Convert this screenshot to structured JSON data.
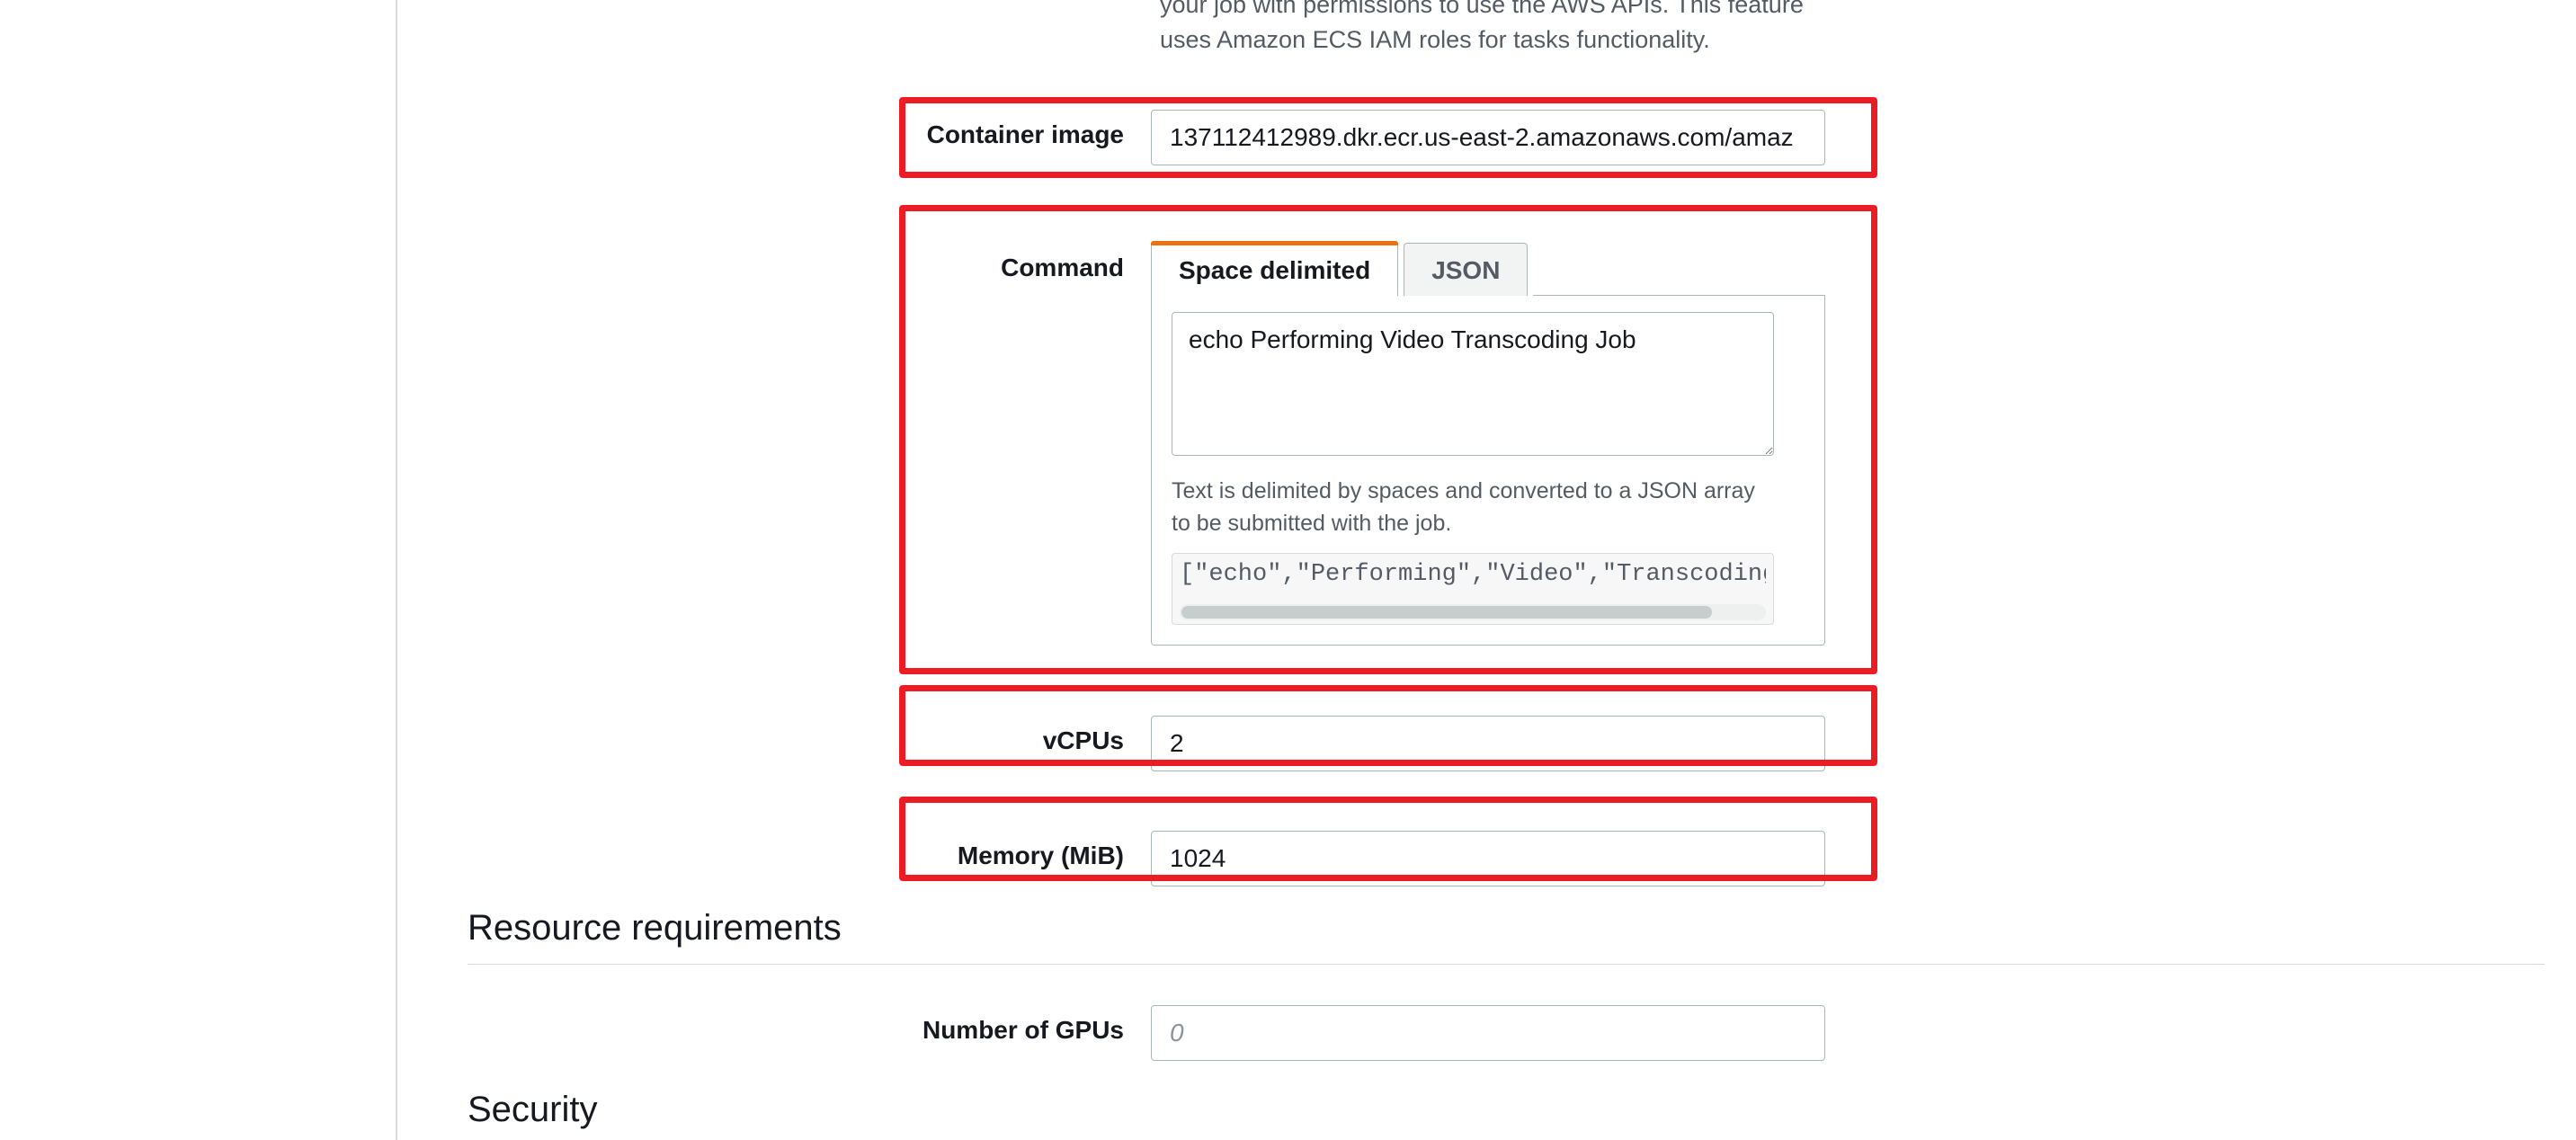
{
  "intro": "your job with permissions to use the AWS APIs. This feature uses Amazon ECS IAM roles for tasks functionality.",
  "fields": {
    "container_image": {
      "label": "Container image",
      "value": "137112412989.dkr.ecr.us-east-2.amazonaws.com/amaz"
    },
    "command": {
      "label": "Command",
      "tab_space": "Space delimited",
      "tab_json": "JSON",
      "value": "echo Performing Video Transcoding Job",
      "help": "Text is delimited by spaces and converted to a JSON array to be submitted with the job.",
      "json_preview": "[\"echo\",\"Performing\",\"Video\",\"Transcoding\",\"J"
    },
    "vcpu": {
      "label": "vCPUs",
      "value": "2"
    },
    "memory": {
      "label": "Memory (MiB)",
      "value": "1024"
    },
    "gpus": {
      "label": "Number of GPUs",
      "value": "",
      "placeholder": "0"
    }
  },
  "sections": {
    "resource": "Resource requirements",
    "security": "Security"
  }
}
